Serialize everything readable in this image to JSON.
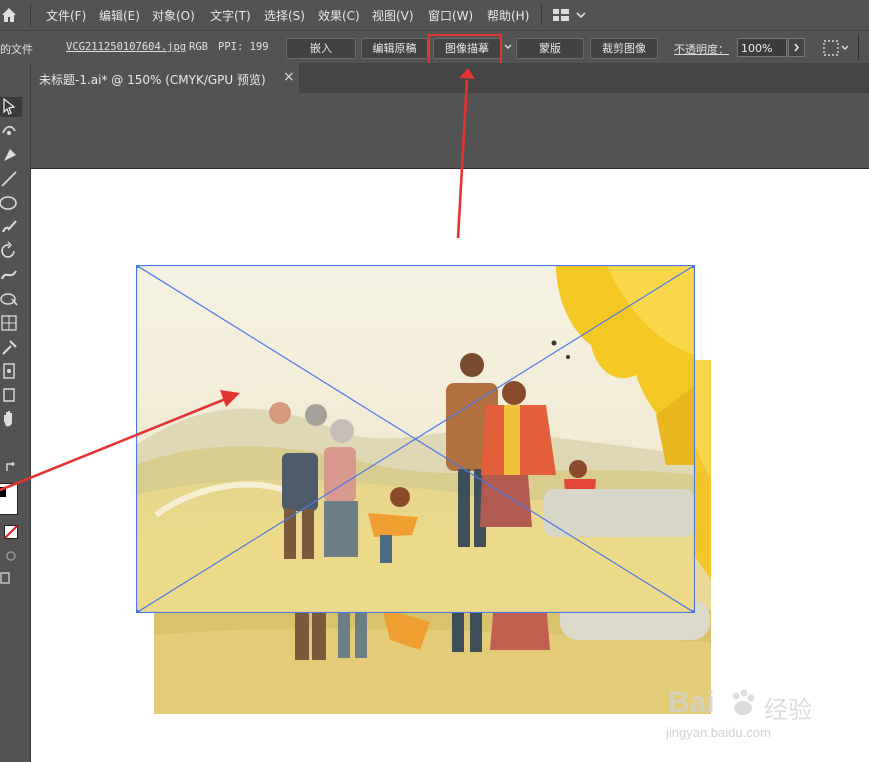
{
  "menubar": {
    "items": [
      "文件(F)",
      "编辑(E)",
      "对象(O)",
      "文字(T)",
      "选择(S)",
      "效果(C)",
      "视图(V)",
      "窗口(W)",
      "帮助(H)"
    ]
  },
  "controlbar": {
    "label_left": "的文件",
    "filename": "VCG211250107604.jpg",
    "colormode": "RGB",
    "ppi": "PPI: 199",
    "embed_btn": "嵌入",
    "edit_original_btn": "编辑原稿",
    "image_trace_btn": "图像描摹",
    "mask_btn": "蒙版",
    "crop_btn": "裁剪图像",
    "opacity_label": "不透明度：",
    "opacity_value": "100%"
  },
  "tab": {
    "title": "未标题-1.ai* @ 150% (CMYK/GPU 预览)",
    "close": "×"
  },
  "watermark": {
    "logo_text": "Bai",
    "logo_suffix": "经验",
    "url": "jingyan.baidu.com"
  },
  "colors": {
    "annotation_red": "#e53333",
    "selection_blue": "#4a78e8",
    "ui_gray": "#535353"
  }
}
